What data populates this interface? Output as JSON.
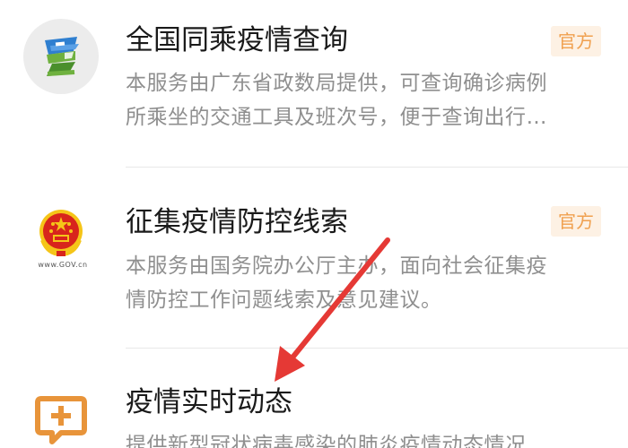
{
  "services": [
    {
      "title": "全国同乘疫情查询",
      "badge": "官方",
      "desc_lines": [
        "本服务由广东省政数局提供，可查询确诊病例",
        "所乘坐的交通工具及班次号，便于查询出行…"
      ],
      "icon": "travel-search-icon"
    },
    {
      "title": "征集疫情防控线索",
      "badge": "官方",
      "desc_lines": [
        "本服务由国务院办公厅主办，面向社会征集疫",
        "情防控工作问题线索及意见建议。"
      ],
      "icon": "national-emblem-icon",
      "icon_text": "www.GOV.cn"
    },
    {
      "title": "疫情实时动态",
      "desc_lines": [
        "提供新型冠状病毒感染的肺炎疫情动态情况"
      ],
      "icon": "medical-chat-icon"
    }
  ],
  "colors": {
    "title": "#1a1a1a",
    "desc": "#8f8f8f",
    "badge_bg": "#fdf1e4",
    "badge_text": "#f0a04e",
    "arrow": "#e53935",
    "icon_orange": "#e8943a",
    "icon_green": "#6fb13f",
    "icon_blue": "#2f7fd0",
    "emblem_red": "#d8251c",
    "emblem_gold": "#f5c518"
  }
}
